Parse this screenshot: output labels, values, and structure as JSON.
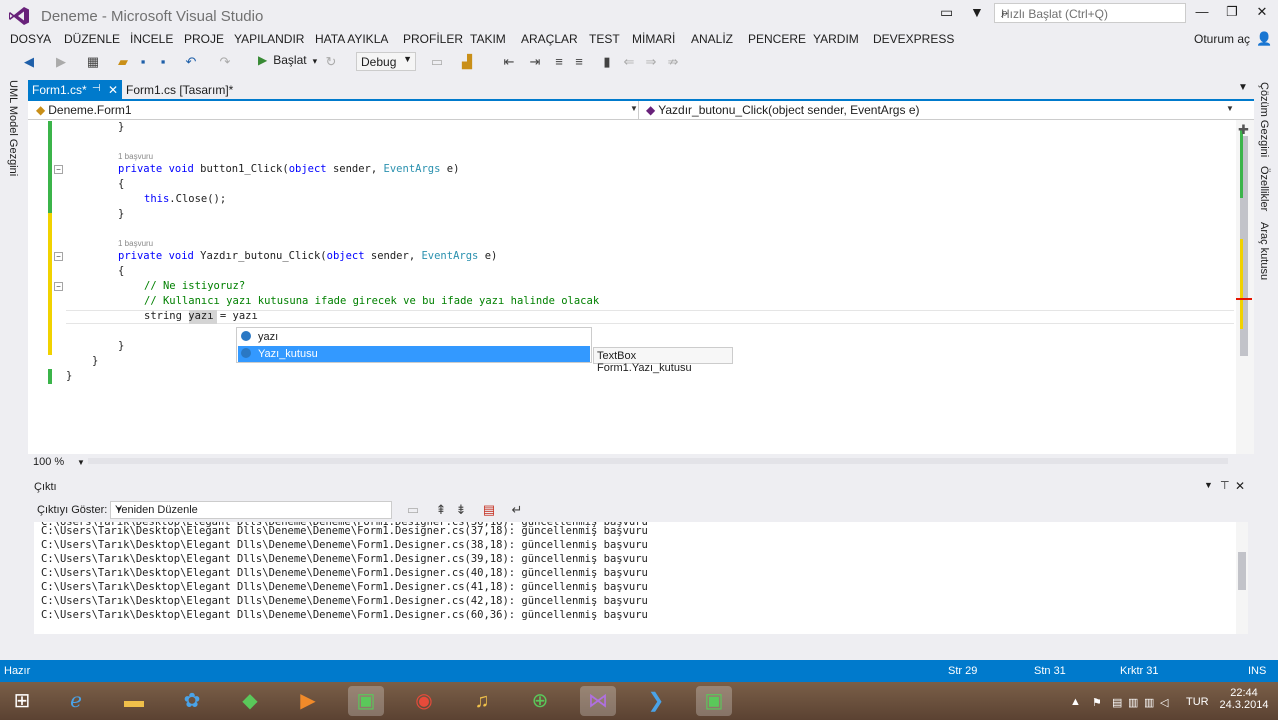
{
  "window": {
    "title": "Deneme - Microsoft Visual Studio",
    "quick_launch_placeholder": "Hızlı Başlat (Ctrl+Q)",
    "sign_in": "Oturum aç"
  },
  "menu": [
    "DOSYA",
    "DÜZENLE",
    "İNCELE",
    "PROJE",
    "YAPILANDIR",
    "HATA AYIKLA",
    "PROFİLER",
    "TAKIM",
    "ARAÇLAR",
    "TEST",
    "MİMARİ",
    "ANALİZ",
    "PENCERE",
    "YARDIM",
    "DEVEXPRESS"
  ],
  "toolbar": {
    "start_label": "Başlat",
    "config": "Debug"
  },
  "left_panel": {
    "label": "UML Model Gezgini"
  },
  "right_panel": {
    "labels": [
      "Çözüm Gezgini",
      "Özellikler",
      "Araç kutusu"
    ]
  },
  "tabs": [
    {
      "label": "Form1.cs*",
      "active": true
    },
    {
      "label": "Form1.cs [Tasarım]*",
      "active": false
    }
  ],
  "nav": {
    "class": "Deneme.Form1",
    "member": "Yazdır_butonu_Click(object sender, EventArgs e)"
  },
  "code": {
    "l1": "}",
    "ref1": "1 başvuru",
    "l2_kw": "private void",
    "l2_name": " button1_Click(",
    "l2_kw2": "object",
    "l2_mid": " sender, ",
    "l2_ty": "EventArgs",
    "l2_end": " e)",
    "l3": "{",
    "l4_kw": "this",
    "l4_rest": ".Close();",
    "l5": "}",
    "ref2": "1 başvuru",
    "l6_kw": "private void",
    "l6_name": " Yazdır_butonu_Click(",
    "l6_kw2": "object",
    "l6_mid": " sender, ",
    "l6_ty": "EventArgs",
    "l6_end": " e)",
    "l7": "{",
    "l8": "// Ne istiyoruz?",
    "l9": "// Kullanıcı yazı kutusuna ifade girecek ve bu ifade yazı halinde olacak",
    "l10": "string yazı = yazı",
    "l11": "}",
    "l12": "}",
    "l13": "}"
  },
  "intellisense": {
    "items": [
      "yazı",
      "Yazı_kutusu"
    ],
    "selected": "Yazı_kutusu",
    "tooltip": "TextBox Form1.Yazı_kutusu"
  },
  "zoom": "100 %",
  "output": {
    "title": "Çıktı",
    "show_label": "Çıktıyı Göster:",
    "show_value": "Yeniden Düzenle",
    "lines": [
      "C:\\Users\\Tarık\\Desktop\\Elegant Dlls\\Deneme\\Deneme\\Form1.Designer.cs(37,18): güncellenmiş başvuru",
      "C:\\Users\\Tarık\\Desktop\\Elegant Dlls\\Deneme\\Deneme\\Form1.Designer.cs(38,18): güncellenmiş başvuru",
      "C:\\Users\\Tarık\\Desktop\\Elegant Dlls\\Deneme\\Deneme\\Form1.Designer.cs(39,18): güncellenmiş başvuru",
      "C:\\Users\\Tarık\\Desktop\\Elegant Dlls\\Deneme\\Deneme\\Form1.Designer.cs(40,18): güncellenmiş başvuru",
      "C:\\Users\\Tarık\\Desktop\\Elegant Dlls\\Deneme\\Deneme\\Form1.Designer.cs(41,18): güncellenmiş başvuru",
      "C:\\Users\\Tarık\\Desktop\\Elegant Dlls\\Deneme\\Deneme\\Form1.Designer.cs(42,18): güncellenmiş başvuru",
      "C:\\Users\\Tarık\\Desktop\\Elegant Dlls\\Deneme\\Deneme\\Form1.Designer.cs(60,36): güncellenmiş başvuru"
    ]
  },
  "status": {
    "ready": "Hazır",
    "line": "Str 29",
    "col": "Stn 31",
    "char": "Krktr 31",
    "mode": "INS"
  },
  "taskbar": {
    "lang": "TUR",
    "time": "22:44",
    "date": "24.3.2014"
  },
  "colors": {
    "accent": "#007acc",
    "keyword": "#0000ff",
    "type": "#2b91af",
    "comment": "#008000",
    "selection": "#3399ff"
  }
}
